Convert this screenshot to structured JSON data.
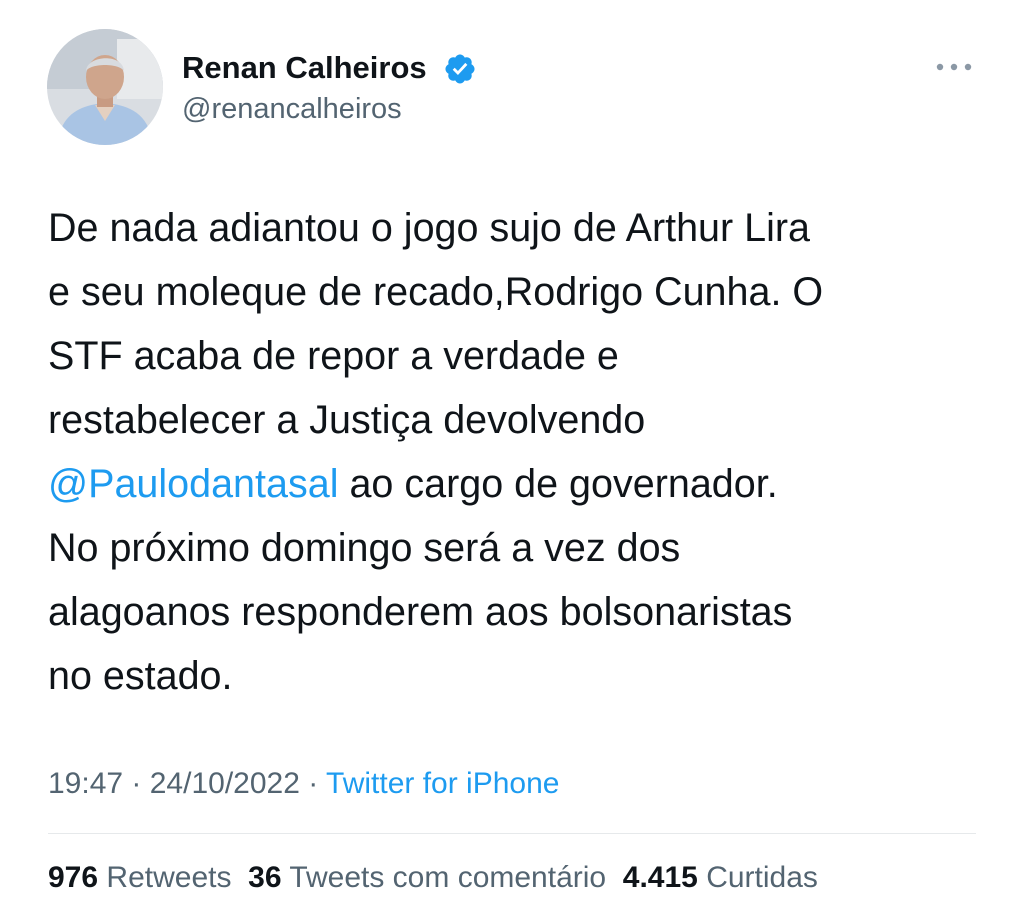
{
  "author": {
    "display_name": "Renan Calheiros",
    "handle": "@renancalheiros",
    "verified": true,
    "avatar_icon": "profile-photo"
  },
  "tweet": {
    "lines": [
      "De nada adiantou o jogo sujo de Arthur Lira",
      "e seu moleque de recado,Rodrigo Cunha. O",
      "STF acaba de repor a verdade e",
      "restabelecer a Justiça devolvendo"
    ],
    "mention": "@Paulodantasal",
    "mention_rest": " ao cargo de governador.",
    "lines_after": [
      "No próximo domingo será a vez dos",
      "alagoanos responderem aos bolsonaristas",
      "no estado."
    ]
  },
  "meta": {
    "time": "19:47",
    "separator": " · ",
    "date": "24/10/2022",
    "source": "Twitter for iPhone"
  },
  "stats": {
    "retweets_count": "976",
    "retweets_label": "Retweets",
    "quotes_count": "36",
    "quotes_label": "Tweets com comentário",
    "likes_count": "4.415",
    "likes_label": "Curtidas"
  },
  "colors": {
    "link": "#1d9bf0",
    "secondary_text": "#536471",
    "primary_text": "#0f1419",
    "verified_badge": "#1d9bf0"
  },
  "icons": {
    "more": "more-horizontal-icon",
    "verified": "verified-badge-icon"
  }
}
